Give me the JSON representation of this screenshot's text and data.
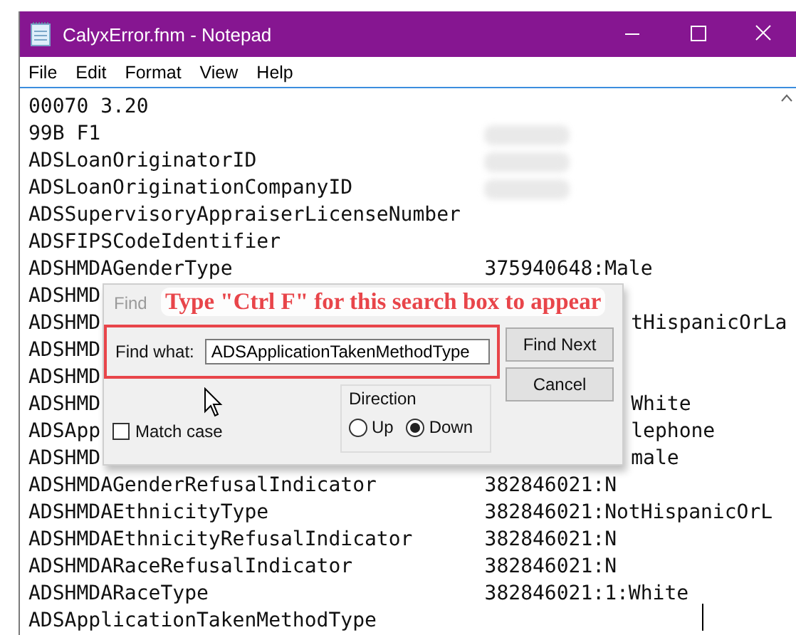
{
  "window": {
    "title": "CalyxError.fnm - Notepad"
  },
  "menu": [
    "File",
    "Edit",
    "Format",
    "View",
    "Help"
  ],
  "lines_above": [
    {
      "left": "00070 3.20",
      "blurred": false
    },
    {
      "left": "99B F1",
      "blurred": true
    },
    {
      "left": "ADSLoanOriginatorID",
      "blurred": true
    },
    {
      "left": "ADSLoanOriginationCompanyID",
      "blurred": true
    },
    {
      "left": "ADSSupervisoryAppraiserLicenseNumber",
      "blurred": false
    },
    {
      "left": "ADSFIPSCodeIdentifier",
      "blurred": false
    },
    {
      "left": "ADSHMDAGenderType",
      "right": "375940648:Male",
      "blurred": false
    }
  ],
  "lines_beside_dialog": [
    {
      "left": "ADSHMD"
    },
    {
      "left": "ADSHMD",
      "right": "tHispanicOrLa"
    },
    {
      "left": "ADSHMD"
    },
    {
      "left": "ADSHMD"
    },
    {
      "left": "ADSHMD",
      "right": "White"
    },
    {
      "left": "ADSApp",
      "right": "lephone"
    },
    {
      "left": "ADSHMD",
      "right": "male"
    }
  ],
  "lines_below": [
    {
      "left": "ADSHMDAGenderRefusalIndicator",
      "right": "382846021:N"
    },
    {
      "left": "ADSHMDAEthnicityType",
      "right": "382846021:NotHispanicOrL"
    },
    {
      "left": "ADSHMDAEthnicityRefusalIndicator",
      "right": "382846021:N"
    },
    {
      "left": "ADSHMDARaceRefusalIndicator",
      "right": "382846021:N"
    },
    {
      "left": "ADSHMDARaceType",
      "right": "382846021:1:White"
    },
    {
      "left": "ADSApplicationTakenMethodType"
    }
  ],
  "annotation": {
    "text": "Type \"Ctrl F\" for this search box to appear"
  },
  "find_dialog": {
    "title": "Find",
    "find_what_label": "Find what:",
    "find_what_value": "ADSApplicationTakenMethodType",
    "find_next_button": "Find Next",
    "cancel_button": "Cancel",
    "direction": {
      "label": "Direction",
      "options": [
        {
          "label": "Up",
          "selected": false
        },
        {
          "label": "Down",
          "selected": true
        }
      ]
    },
    "match_case": {
      "label": "Match case",
      "checked": false
    }
  }
}
